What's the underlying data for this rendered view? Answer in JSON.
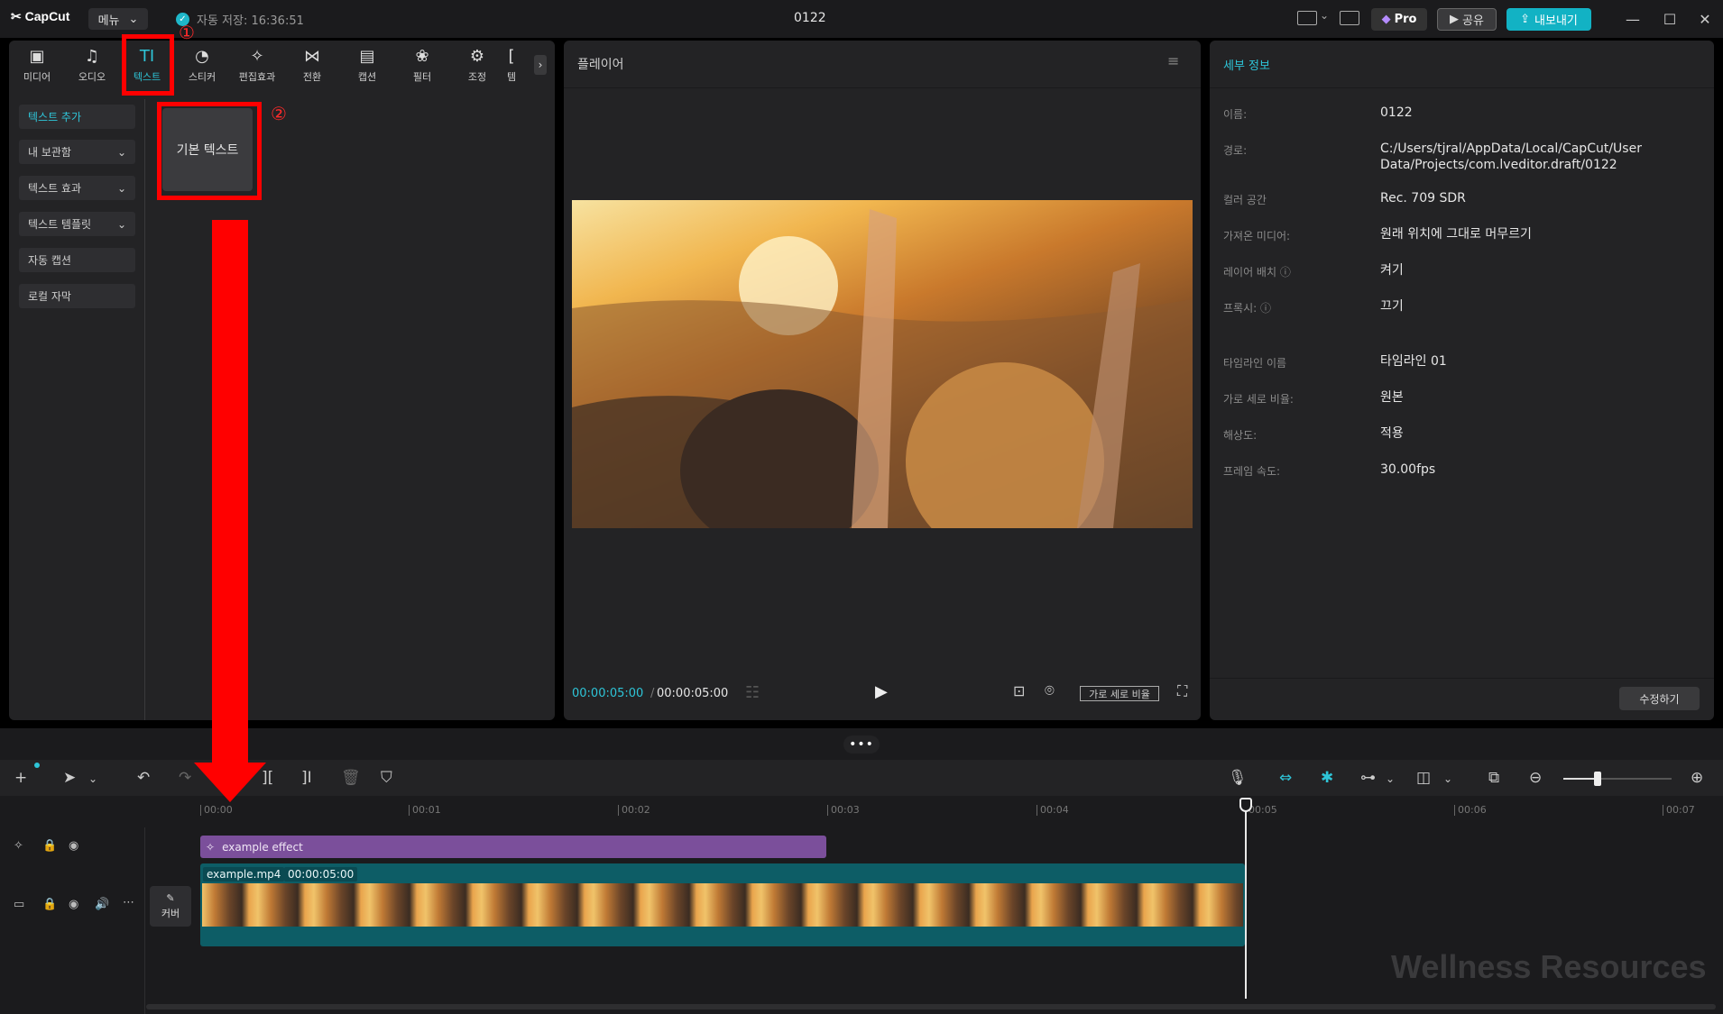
{
  "app": {
    "logo": "CapCut",
    "menu_label": "메뉴",
    "autosave": "자동 저장: 16:36:51",
    "project_title": "0122",
    "pro_label": "Pro",
    "share_label": "공유",
    "export_label": "내보내기"
  },
  "left_toolbar": [
    {
      "label": "미디어",
      "icon": "media-icon"
    },
    {
      "label": "오디오",
      "icon": "audio-icon"
    },
    {
      "label": "텍스트",
      "icon": "text-icon"
    },
    {
      "label": "스티커",
      "icon": "sticker-icon"
    },
    {
      "label": "편집효과",
      "icon": "effects-icon"
    },
    {
      "label": "전환",
      "icon": "transition-icon"
    },
    {
      "label": "캡션",
      "icon": "caption-icon"
    },
    {
      "label": "필터",
      "icon": "filter-icon"
    },
    {
      "label": "조정",
      "icon": "adjust-icon"
    },
    {
      "label": "템",
      "icon": "template-icon"
    }
  ],
  "text_sidebar": [
    {
      "label": "텍스트 추가"
    },
    {
      "label": "내 보관함"
    },
    {
      "label": "텍스트 효과"
    },
    {
      "label": "텍스트 템플릿"
    },
    {
      "label": "자동 캡션"
    },
    {
      "label": "로컬 자막"
    }
  ],
  "basic_text_card": "기본 텍스트",
  "annotations": {
    "step1": "①",
    "step2": "②",
    "color": "#ff0000"
  },
  "player": {
    "title": "플레이어",
    "current_time": "00:00:05:00",
    "separator": "/",
    "total_time": "00:00:05:00",
    "ratio_label": "가로 세로 비율"
  },
  "details": {
    "title": "세부 정보",
    "rows": [
      {
        "label": "이름:",
        "value": "0122"
      },
      {
        "label": "경로:",
        "value": "C:/Users/tjral/AppData/Local/CapCut/User Data/Projects/com.lveditor.draft/0122"
      },
      {
        "label": "컬러 공간",
        "value": "Rec. 709 SDR"
      },
      {
        "label": "가져온 미디어:",
        "value": "원래 위치에 그대로 머무르기"
      },
      {
        "label": "레이어 배치 ⓘ",
        "value": "켜기"
      },
      {
        "label": "프록시: ⓘ",
        "value": "끄기"
      },
      {
        "label": "타임라인 이름",
        "value": "타임라인 01"
      },
      {
        "label": "가로 세로 비율:",
        "value": "원본"
      },
      {
        "label": "해상도:",
        "value": "적용"
      },
      {
        "label": "프레임 속도:",
        "value": "30.00fps"
      }
    ],
    "modify_label": "수정하기"
  },
  "timeline": {
    "ruler": [
      "00:00",
      "00:01",
      "00:02",
      "00:03",
      "00:04",
      "00:05",
      "00:06",
      "00:07"
    ],
    "effect_clip": "example effect",
    "video_clip_name": "example.mp4",
    "video_clip_duration": "00:00:05:00",
    "cover_label": "커버"
  },
  "watermark": "Wellness Resources",
  "colors": {
    "accent": "#2ec5d8",
    "panel": "#232325",
    "background": "#1b1b1d",
    "effect_clip": "#7b4f9b",
    "video_clip": "#0d5d66"
  }
}
